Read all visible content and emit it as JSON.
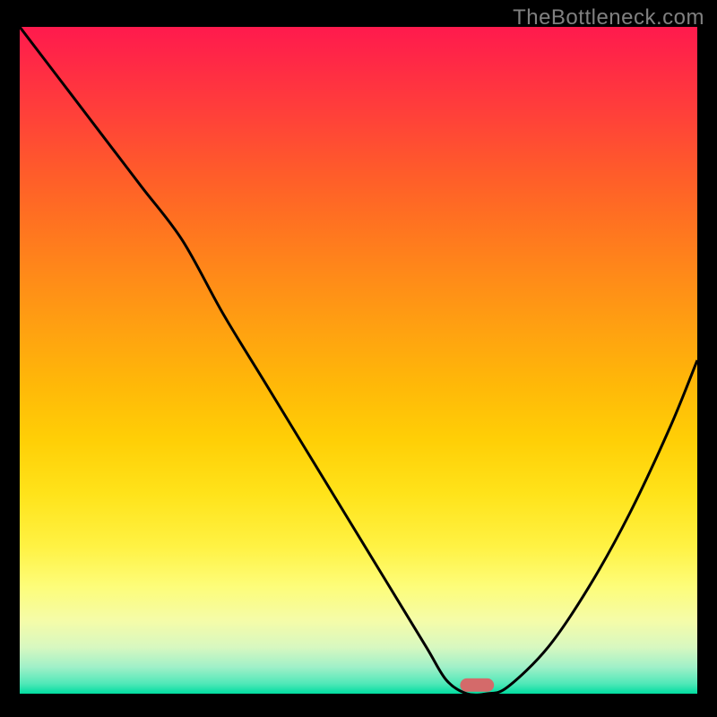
{
  "watermark": "TheBottleneck.com",
  "chart_data": {
    "type": "line",
    "title": "",
    "xlabel": "",
    "ylabel": "",
    "xlim": [
      0,
      100
    ],
    "ylim": [
      0,
      100
    ],
    "x": [
      0,
      6,
      12,
      18,
      24,
      30,
      36,
      42,
      48,
      54,
      60,
      63,
      66,
      69,
      72,
      78,
      84,
      90,
      96,
      100
    ],
    "values": [
      100,
      92,
      84,
      76,
      68,
      57,
      47,
      37,
      27,
      17,
      7,
      2,
      0,
      0,
      1,
      7,
      16,
      27,
      40,
      50
    ],
    "marker": {
      "x": 67.5,
      "y": 0,
      "width": 5,
      "height": 2,
      "color": "#d46a6a"
    },
    "background_gradient": {
      "top": "#ff1a4d",
      "mid_upper": "#ff8c18",
      "mid": "#ffe31a",
      "mid_lower": "#fdfd7a",
      "bottom": "#00dda0"
    }
  }
}
